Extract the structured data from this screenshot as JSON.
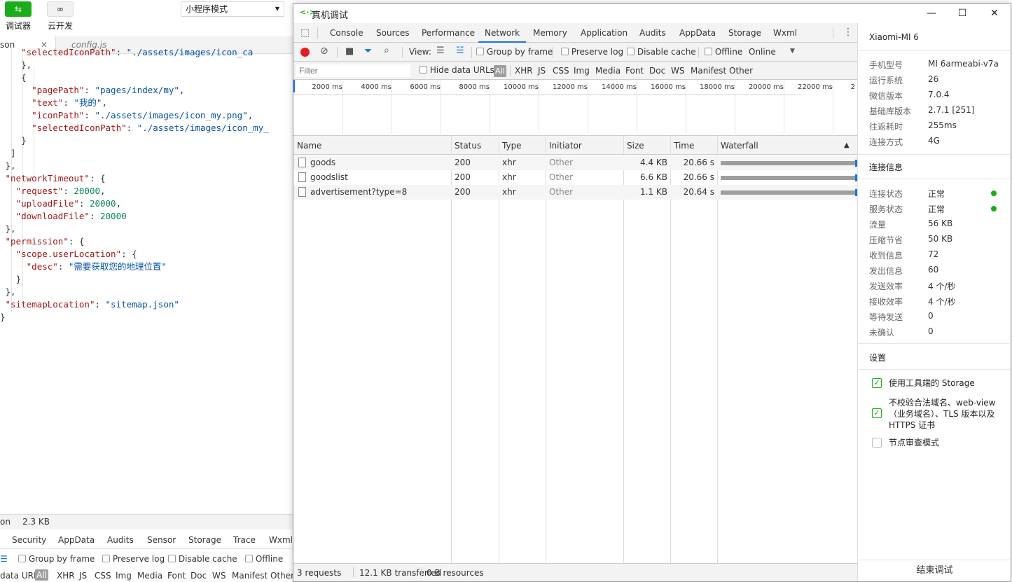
{
  "ide": {
    "tools": [
      {
        "label": "调试器"
      },
      {
        "label": "云开发"
      }
    ],
    "mode_select": "小程序模式",
    "file_tabs": [
      "son",
      "config.js"
    ],
    "code_lines": [
      {
        "t": "    \"selectedIconPath\": \"./assets/images/icon_ca"
      },
      {
        "t": "    },"
      },
      {
        "t": "    {"
      },
      {
        "t": "      \"pagePath\": \"pages/index/my\","
      },
      {
        "t": "      \"text\": \"我的\","
      },
      {
        "t": "      \"iconPath\": \"./assets/images/icon_my.png\","
      },
      {
        "t": "      \"selectedIconPath\": \"./assets/images/icon_my_"
      },
      {
        "t": "    }"
      },
      {
        "t": "  ]"
      },
      {
        "t": " },"
      },
      {
        "t": " \"networkTimeout\": {"
      },
      {
        "t": "   \"request\": 20000,"
      },
      {
        "t": "   \"uploadFile\": 20000,"
      },
      {
        "t": "   \"downloadFile\": 20000"
      },
      {
        "t": " },"
      },
      {
        "t": " \"permission\": {"
      },
      {
        "t": "   \"scope.userLocation\": {"
      },
      {
        "t": "     \"desc\": \"需要获取您的地理位置\""
      },
      {
        "t": "   }"
      },
      {
        "t": " },"
      },
      {
        "t": " \"sitemapLocation\": \"sitemap.json\""
      },
      {
        "t": "}"
      }
    ],
    "status_left": "on",
    "status_size": "2.3 KB",
    "dt_tabs": [
      "Security",
      "AppData",
      "Audits",
      "Sensor",
      "Storage",
      "Trace",
      "Wxml"
    ],
    "dt_bar": [
      "Group by frame",
      "Preserve log",
      "Disable cache",
      "Offline"
    ],
    "dt_filter": [
      "data URLs",
      "All",
      "XHR",
      "JS",
      "CSS",
      "Img",
      "Media",
      "Font",
      "Doc",
      "WS",
      "Manifest",
      "Other"
    ]
  },
  "window": {
    "title": "真机调试",
    "icon": "<·>",
    "controls": {
      "minimize": "—",
      "maximize": "☐",
      "close": "✕"
    }
  },
  "devtools": {
    "tabs": [
      "Console",
      "Sources",
      "Performance",
      "Network",
      "Memory",
      "Application",
      "Audits",
      "AppData",
      "Storage",
      "Wxml"
    ],
    "active_tab": "Network",
    "toolbar": {
      "view_label": "View:",
      "group_by_frame": "Group by frame",
      "preserve_log": "Preserve log",
      "disable_cache": "Disable cache",
      "offline": "Offline",
      "throttle": "Online"
    },
    "filter": {
      "placeholder": "Filter",
      "hide_data_urls": "Hide data URLs",
      "types": [
        "All",
        "XHR",
        "JS",
        "CSS",
        "Img",
        "Media",
        "Font",
        "Doc",
        "WS",
        "Manifest",
        "Other"
      ]
    },
    "overview_ticks": [
      "2000 ms",
      "4000 ms",
      "6000 ms",
      "8000 ms",
      "10000 ms",
      "12000 ms",
      "14000 ms",
      "16000 ms",
      "18000 ms",
      "20000 ms",
      "22000 ms",
      "2"
    ],
    "columns": [
      "Name",
      "Status",
      "Type",
      "Initiator",
      "Size",
      "Time",
      "Waterfall"
    ],
    "sort_icon": "▲",
    "rows": [
      {
        "name": "goods",
        "status": "200",
        "type": "xhr",
        "initiator": "Other",
        "size": "4.4 KB",
        "time": "20.66 s"
      },
      {
        "name": "goodslist",
        "status": "200",
        "type": "xhr",
        "initiator": "Other",
        "size": "6.6 KB",
        "time": "20.66 s"
      },
      {
        "name": "advertisement?type=8",
        "status": "200",
        "type": "xhr",
        "initiator": "Other",
        "size": "1.1 KB",
        "time": "20.64 s"
      }
    ],
    "status_bar": [
      "3 requests",
      "12.1 KB transferred",
      "0 B resources"
    ]
  },
  "panel": {
    "device": "Xiaomi-MI 6",
    "device_info": [
      {
        "k": "手机型号",
        "v": "MI 6armeabi-v7a"
      },
      {
        "k": "运行系统",
        "v": "26"
      },
      {
        "k": "微信版本",
        "v": "7.0.4"
      },
      {
        "k": "基础库版本",
        "v": "2.7.1 [251]"
      },
      {
        "k": "往返耗时",
        "v": "255ms"
      },
      {
        "k": "连接方式",
        "v": "4G"
      }
    ],
    "conn_title": "连接信息",
    "conn_info": [
      {
        "k": "连接状态",
        "v": "正常",
        "dot": true
      },
      {
        "k": "服务状态",
        "v": "正常",
        "dot": true
      },
      {
        "k": "流量",
        "v": "56 KB"
      },
      {
        "k": "压缩节省",
        "v": "50 KB"
      },
      {
        "k": "收到信息",
        "v": "72"
      },
      {
        "k": "发出信息",
        "v": "60"
      },
      {
        "k": "发送效率",
        "v": "4 个/秒"
      },
      {
        "k": "接收效率",
        "v": "4 个/秒"
      },
      {
        "k": "等待发送",
        "v": "0"
      },
      {
        "k": "未确认",
        "v": "0"
      }
    ],
    "settings_title": "设置",
    "settings": [
      {
        "label": "使用工具端的 Storage",
        "checked": true
      },
      {
        "label": "不校验合法域名、web-view（业务域名）、TLS 版本以及 HTTPS 证书",
        "checked": true
      },
      {
        "label": "节点审查模式",
        "checked": false
      }
    ],
    "end_button": "结束调试",
    "accent": "#1aad19"
  }
}
